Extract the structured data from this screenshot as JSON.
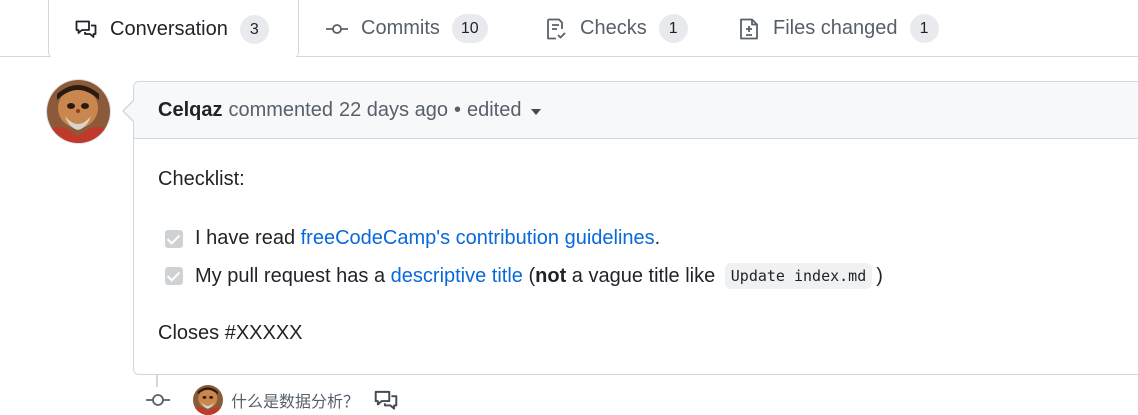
{
  "tabs": [
    {
      "label": "Conversation",
      "count": "3",
      "icon": "comment-discussion-icon",
      "selected": true
    },
    {
      "label": "Commits",
      "count": "10",
      "icon": "git-commit-icon",
      "selected": false
    },
    {
      "label": "Checks",
      "count": "1",
      "icon": "checklist-icon",
      "selected": false
    },
    {
      "label": "Files changed",
      "count": "1",
      "icon": "file-diff-icon",
      "selected": false
    }
  ],
  "comment": {
    "author": "Celqaz",
    "action": "commented",
    "time_ago": "22 days ago",
    "separator": "•",
    "edited": "edited",
    "body": {
      "checklist_title": "Checklist:",
      "task1": {
        "prefix": "I have read ",
        "link": "freeCodeCamp's contribution guidelines",
        "suffix": ".",
        "checked": true
      },
      "task2": {
        "prefix": "My pull request has a ",
        "link": "descriptive title",
        "paren_open": " (",
        "bold": "not",
        "middle": " a vague title like ",
        "code": "Update index.md",
        "paren_close": ")",
        "checked": true
      },
      "closes": "Closes #XXXXX"
    }
  },
  "timeline": {
    "commit_message": "什么是数据分析？",
    "icons": [
      "git-commit-icon",
      "comment-discussion-icon"
    ]
  },
  "colors": {
    "link": "#0969da",
    "border": "#d0d7de",
    "header_bg": "#f6f8fa",
    "muted_text": "#57606a",
    "counter_bg": "#e8eaed"
  }
}
